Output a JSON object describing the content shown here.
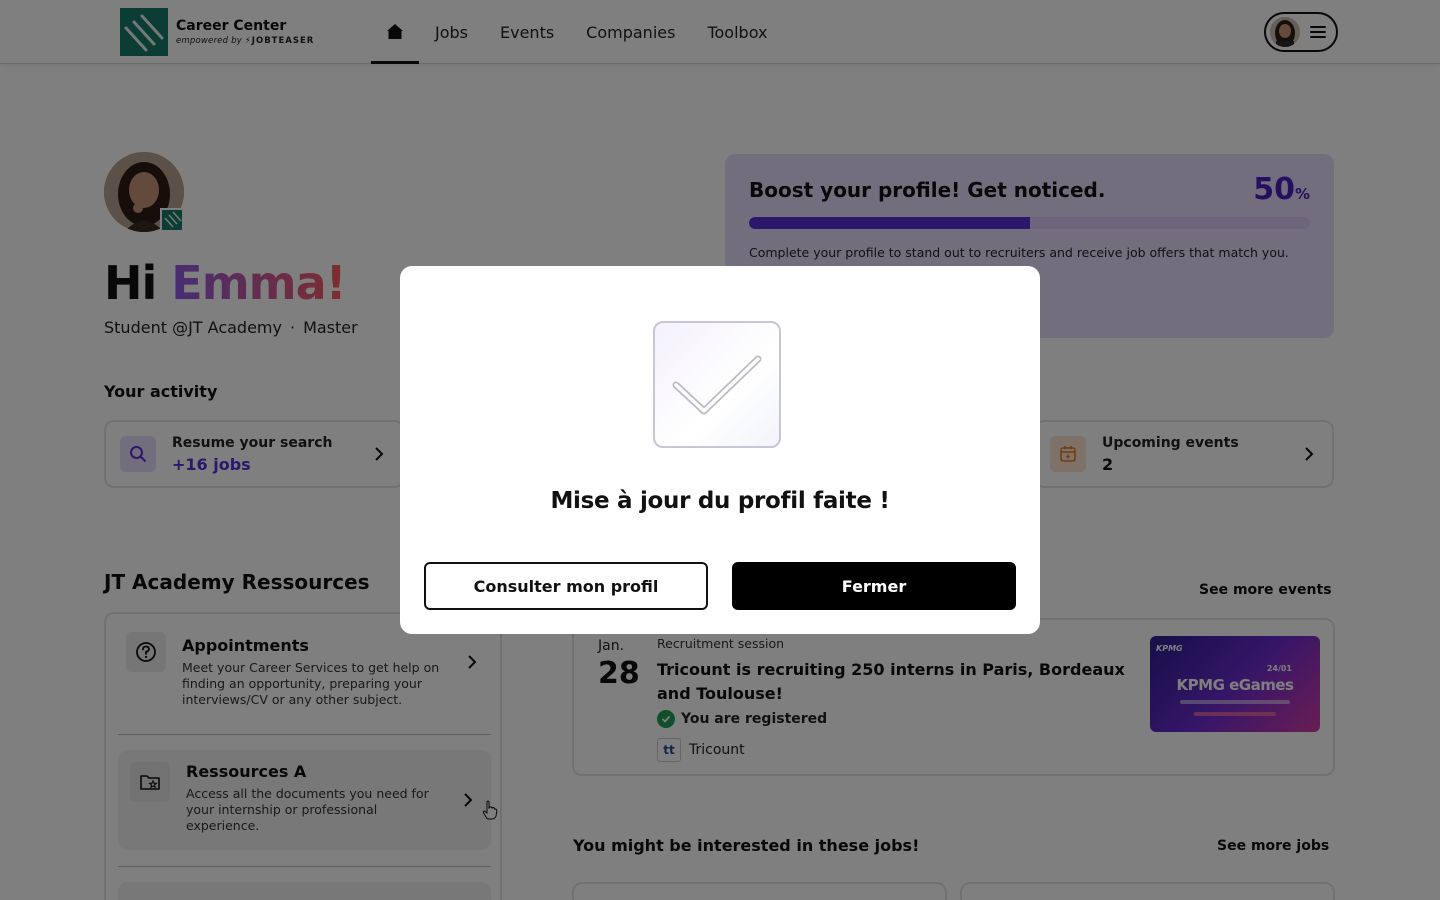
{
  "header": {
    "logo_title": "Career Center",
    "logo_sub_prefix": "empowered by",
    "logo_sub_brand": "⚡JOBTEASER",
    "nav": [
      "Jobs",
      "Events",
      "Companies",
      "Toolbox"
    ]
  },
  "profile": {
    "greeting": "Hi",
    "name": "Emma!",
    "school": "Student @JT Academy",
    "separator": "·",
    "level": "Master"
  },
  "activity": {
    "label": "Your activity",
    "search_title": "Resume your search",
    "search_value": "+16 jobs",
    "events_title": "Upcoming events",
    "events_value": "2"
  },
  "boost": {
    "title": "Boost your profile! Get noticed.",
    "percent": "50",
    "percent_sign": "%",
    "progress": 0.5,
    "description": "Complete your profile to stand out to recruiters and receive job offers that match you."
  },
  "resources": {
    "title": "JT Academy Ressources",
    "items": [
      {
        "title": "Appointments",
        "description": "Meet your Career Services to get help on finding an opportunity, preparing your interviews/CV or any other subject."
      },
      {
        "title": "Ressources A",
        "description": "Access all the documents you need for your internship or professional experience."
      }
    ]
  },
  "events": {
    "see_more": "See more events",
    "card": {
      "month": "Jan.",
      "day": "28",
      "type": "Recruitment session",
      "title": "Tricount is recruiting 250 interns in Paris, Bordeaux and Toulouse!",
      "status": "You are registered",
      "company": "Tricount",
      "company_logo": "tt",
      "image_brand": "KPMG",
      "image_title": "KPMG eGames",
      "image_date": "24/01"
    }
  },
  "jobs": {
    "title": "You might be interested in these jobs!",
    "see_more": "See more jobs"
  },
  "modal": {
    "title": "Mise à jour du profil faite !",
    "secondary_button": "Consulter mon profil",
    "primary_button": "Fermer"
  },
  "colors": {
    "brand_green": "#167a68",
    "accent_purple": "#5b2fd8",
    "overlay": "rgba(0,0,0,0.5)"
  }
}
